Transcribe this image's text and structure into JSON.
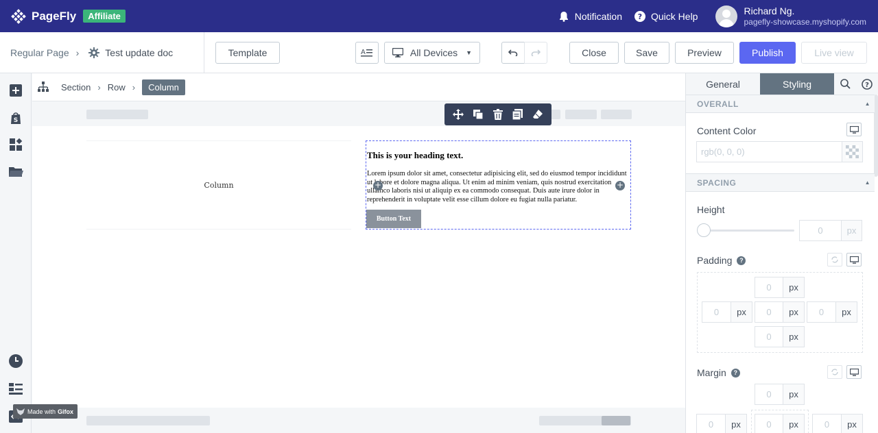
{
  "app": {
    "name": "PageFly",
    "badge": "Affiliate",
    "notification": "Notification",
    "quick_help": "Quick Help",
    "user_name": "Richard Ng.",
    "user_store": "pagefly-showcase.myshopify.com"
  },
  "toolbar": {
    "page_type": "Regular Page",
    "page_name": "Test update doc",
    "template": "Template",
    "device": "All Devices",
    "close": "Close",
    "save": "Save",
    "preview": "Preview",
    "publish": "Publish",
    "live_view": "Live view"
  },
  "breadcrumb": [
    "Section",
    "Row",
    "Column"
  ],
  "canvas": {
    "column_placeholder": "Column",
    "heading": "This is your heading text.",
    "paragraph": "Lorem ipsum dolor sit amet, consectetur adipisicing elit, sed do eiusmod tempor incididunt ut labore et dolore magna aliqua. Ut enim ad minim veniam, quis nostrud exercitation ullamco laboris nisi ut aliquip ex ea commodo consequat. Duis aute irure dolor in reprehenderit in voluptate velit esse cillum dolore eu fugiat nulla pariatur.",
    "button": "Button Text"
  },
  "watermark": {
    "prefix": "Made with",
    "brand": "Gifox"
  },
  "panel": {
    "tabs": [
      "General",
      "Styling"
    ],
    "active_tab": "Styling",
    "overall": "OVERALL",
    "content_color": "Content Color",
    "content_color_placeholder": "rgb(0, 0, 0)",
    "spacing": "SPACING",
    "height": "Height",
    "height_value": "0",
    "unit": "px",
    "padding": "Padding",
    "padding_values": {
      "top": "0",
      "left": "0",
      "center": "0",
      "right": "0",
      "bottom": "0"
    },
    "margin": "Margin",
    "margin_values": {
      "top": "0",
      "left": "0",
      "center": "0",
      "right": "0"
    }
  },
  "colors": {
    "topbar": "#2b2e8a",
    "affiliate": "#3bb57a",
    "publish": "#5b67f1",
    "active_tab": "#637381",
    "selection": "#5b67f1"
  }
}
